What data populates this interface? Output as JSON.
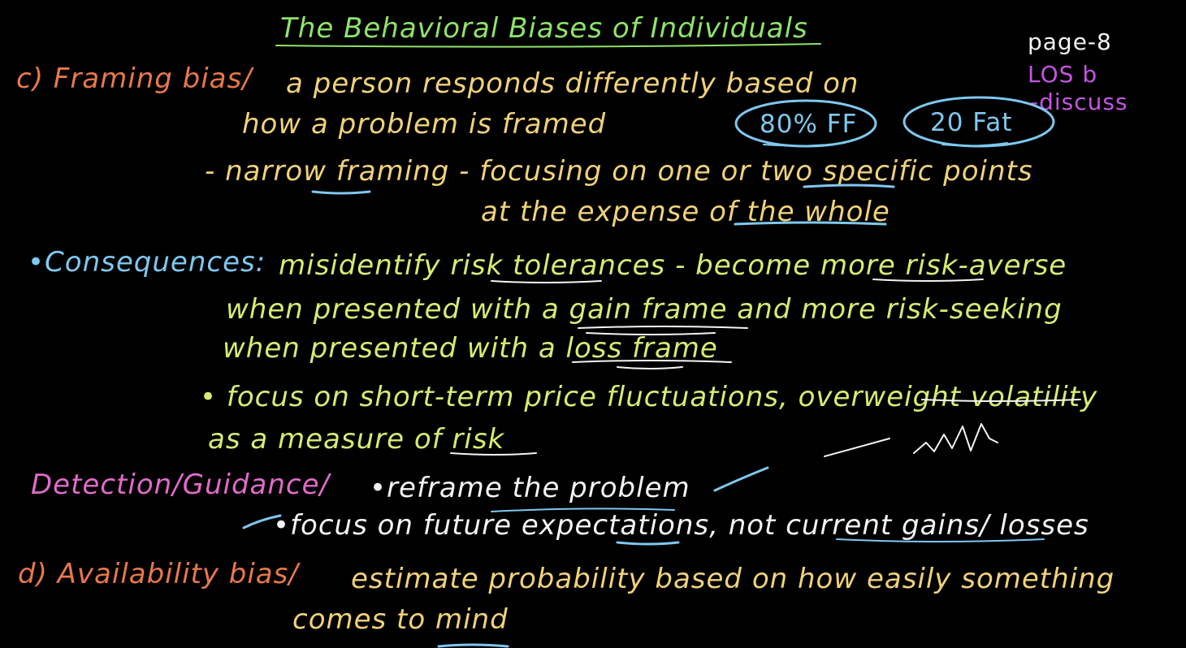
{
  "colors": {
    "background": "#000000",
    "title": "#8fe36a",
    "orange": "#e8784a",
    "yellow": "#f1d27a",
    "blue": "#7ec8f0",
    "green_yellow": "#d9ea72",
    "pink": "#e06bc8",
    "white": "#f4f4f4",
    "purple": "#c455e0"
  },
  "title": "The Behavioral Biases of Individuals",
  "page_note": {
    "page": "page-8",
    "los": "LOS b",
    "discuss": "-discuss"
  },
  "framing": {
    "label": "c) Framing bias/",
    "def_line1": "a person responds differently based on",
    "def_line2": "how a problem is framed",
    "example_a": "80% FF",
    "example_b": "20 Fat",
    "narrow_line1": "- narrow framing - focusing on one or two specific points",
    "narrow_line2": "at the expense of the whole"
  },
  "consequences": {
    "label": "•Consequences:",
    "line1": "misidentify risk tolerances - become more risk-averse",
    "line2": "when presented with a gain frame and more risk-seeking",
    "line3": "when presented with a loss frame",
    "line4": "• focus on short-term price fluctuations, overweight volatility",
    "line5": "as a measure of risk"
  },
  "detection": {
    "label": "Detection/Guidance/",
    "line1": "•reframe the problem",
    "line2": "•focus on future expectations, not current gains/ losses"
  },
  "availability": {
    "label": "d) Availability bias/",
    "line1": "estimate probability based on how easily something",
    "line2": "comes to mind"
  }
}
